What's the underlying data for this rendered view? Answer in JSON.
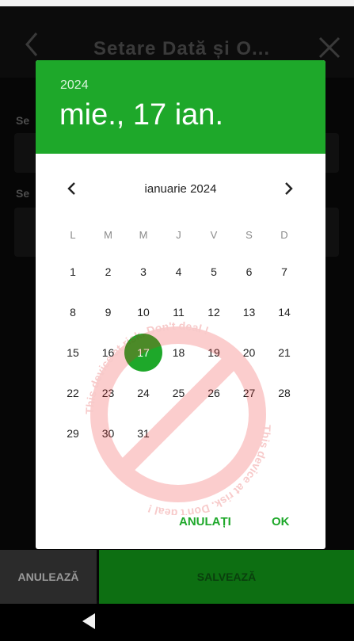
{
  "header": {
    "title": "Setare Dată și O...",
    "back_icon": "chevron-left-icon",
    "close_icon": "close-icon"
  },
  "background": {
    "label1": "Se",
    "label2": "Se"
  },
  "dialog": {
    "year": "2024",
    "selected_date": "mie., 17 ian.",
    "month_label": "ianuarie 2024",
    "weekdays": [
      "L",
      "M",
      "M",
      "J",
      "V",
      "S",
      "D"
    ],
    "weeks": [
      [
        "1",
        "2",
        "3",
        "4",
        "5",
        "6",
        "7"
      ],
      [
        "8",
        "9",
        "10",
        "11",
        "12",
        "13",
        "14"
      ],
      [
        "15",
        "16",
        "17",
        "18",
        "19",
        "20",
        "21"
      ],
      [
        "22",
        "23",
        "24",
        "25",
        "26",
        "27",
        "28"
      ],
      [
        "29",
        "30",
        "31",
        "",
        "",
        "",
        ""
      ]
    ],
    "selected_day": "17",
    "cancel_label": "ANULAȚI",
    "ok_label": "OK",
    "accent_color": "#1ea82a"
  },
  "watermark": {
    "text1": "This device at risk. Don't deal !",
    "text2": "This device at risk. Don't deal !"
  },
  "bottom": {
    "cancel_label": "ANULEAZĂ",
    "save_label": "SALVEAZĂ"
  },
  "navbar": {
    "back_icon": "nav-back-triangle-icon"
  }
}
